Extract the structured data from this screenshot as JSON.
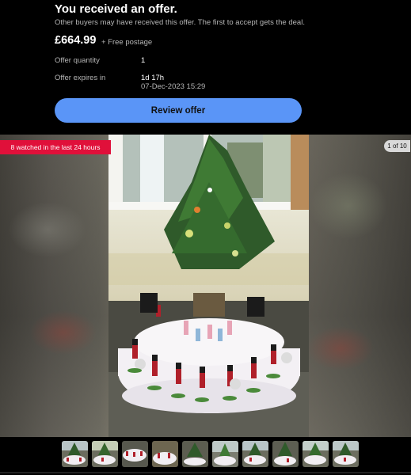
{
  "offer": {
    "title": "You received an offer.",
    "subtitle": "Other buyers may have received this offer. The first to accept gets the deal.",
    "price": "£664.99",
    "postage": "+ Free postage",
    "quantity_label": "Offer quantity",
    "quantity_value": "1",
    "expires_label": "Offer expires in",
    "expires_value": "1d 17h",
    "expires_date": "07-Dec-2023 15:29",
    "review_button": "Review offer"
  },
  "gallery": {
    "watched_badge": "8 watched in the last 24 hours",
    "counter": "1 of 10",
    "thumbnail_count": 10
  },
  "colors": {
    "accent_button": "#5a95f7",
    "badge_red": "#e0103a",
    "background": "#000000"
  },
  "icons": [
    "christmas-tree-photo",
    "thumbnail-image"
  ]
}
